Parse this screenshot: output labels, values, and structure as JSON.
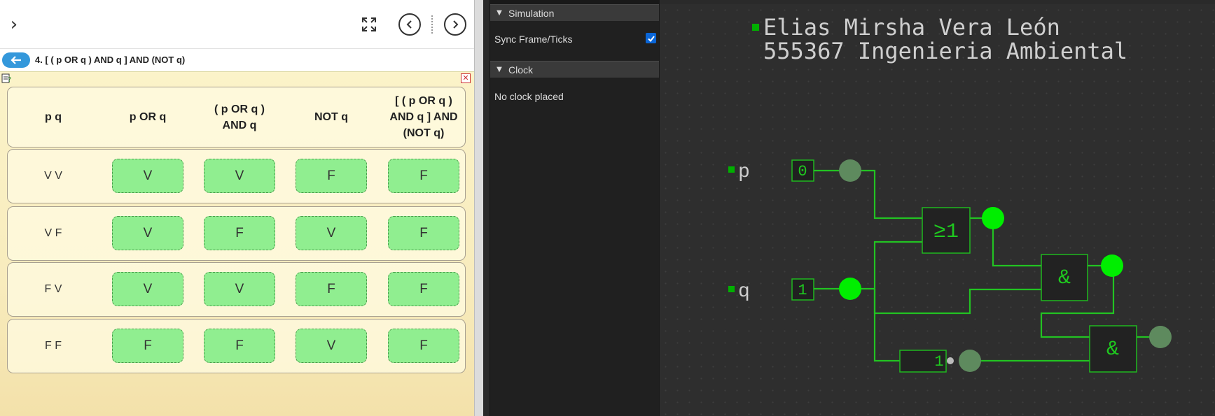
{
  "topbar": {
    "expand_icon": "chevron-right-icon",
    "fullscreen_icon": "fullscreen-icon",
    "prev_icon": "chevron-left-circle-icon",
    "next_icon": "chevron-right-circle-icon"
  },
  "question": {
    "back_icon": "arrow-left-icon",
    "title": "4. [ ( p OR q ) AND q ] AND (NOT q)"
  },
  "truth_table": {
    "headers": [
      "p q",
      "p OR q",
      "( p OR q ) AND q",
      "NOT q",
      "[ ( p OR q ) AND q ] AND (NOT q)"
    ],
    "header_lines": [
      [
        "p q"
      ],
      [
        "p OR q"
      ],
      [
        "( p OR q )",
        "AND q"
      ],
      [
        "NOT q"
      ],
      [
        "[ ( p OR q )",
        "AND q ] AND",
        "(NOT q)"
      ]
    ],
    "rows": [
      {
        "pq": "V V",
        "answers": [
          "V",
          "V",
          "F",
          "F"
        ]
      },
      {
        "pq": "V F",
        "answers": [
          "V",
          "F",
          "V",
          "F"
        ]
      },
      {
        "pq": "F V",
        "answers": [
          "V",
          "V",
          "F",
          "F"
        ]
      },
      {
        "pq": "F F",
        "answers": [
          "F",
          "F",
          "V",
          "F"
        ]
      }
    ],
    "answer_color": "#90ee90"
  },
  "sidebar": {
    "simulation": {
      "title": "Simulation",
      "sync_label": "Sync Frame/Ticks",
      "sync_checked": true
    },
    "clock": {
      "title": "Clock",
      "empty_text": "No clock placed"
    }
  },
  "circuit": {
    "title_line1": "Elias Mirsha Vera León",
    "title_line2": "555367 Ingenieria Ambiental",
    "inputs": [
      {
        "label": "p",
        "value": "0"
      },
      {
        "label": "q",
        "value": "1"
      }
    ],
    "gates": {
      "or_symbol": "≥1",
      "and_symbol": "&",
      "not_symbol": "1"
    },
    "colors": {
      "wire": "#22c322",
      "signal_on": "#00ee00",
      "signal_off": "#5e8a5e",
      "gate_fill": "#222222",
      "gate_stroke": "#1fb81f"
    }
  }
}
